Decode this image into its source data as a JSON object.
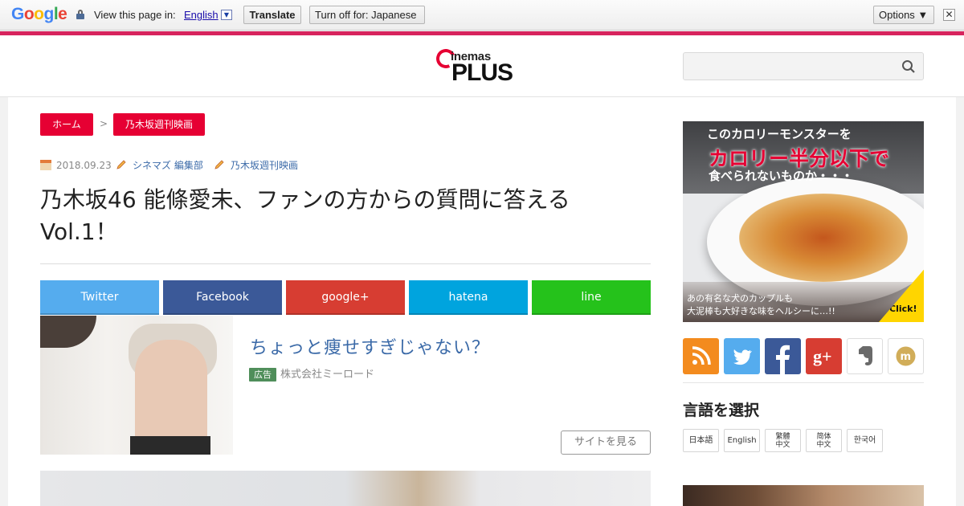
{
  "translate_bar": {
    "logo": "Google",
    "prompt": "View this page in:",
    "language": "English",
    "translate_label": "Translate",
    "turnoff_label": "Turn off for: Japanese",
    "options_label": "Options ▼",
    "close_glyph": "✕"
  },
  "header": {
    "logo_top": "inemas",
    "logo_bottom": "PLUS",
    "search": {
      "value": "",
      "placeholder": ""
    },
    "accent_color": "#d7245d"
  },
  "breadcrumb": {
    "home": "ホーム",
    "separator": ">",
    "category": "乃木坂週刊映画"
  },
  "meta": {
    "date": "2018.09.23",
    "author": "シネマズ 編集部",
    "category": "乃木坂週刊映画"
  },
  "article": {
    "title": "乃木坂46 能條愛未、ファンの方からの質問に答える Vol.1！"
  },
  "share": {
    "twitter": "Twitter",
    "facebook": "Facebook",
    "google": "google+",
    "hatena": "hatena",
    "line": "line"
  },
  "ad": {
    "title": "ちょっと痩せすぎじゃない？",
    "badge": "広告",
    "sponsor": "株式会社ミーロード",
    "cta": "サイトを見る"
  },
  "sidebar": {
    "banner": {
      "line1": "このカロリーモンスターを",
      "line2": "カロリー半分以下で",
      "line3": "食べられないものか・・・",
      "line4": "あの有名な犬のカップルも",
      "line5": "大泥棒も大好きな味をヘルシーに…!!",
      "click": "Click!"
    },
    "sns_icons": [
      "rss-icon",
      "twitter-icon",
      "facebook-icon",
      "google-plus-icon",
      "evernote-icon",
      "mixi-icon"
    ],
    "language_title": "言語を選択",
    "languages": {
      "ja": "日本語",
      "en": "English",
      "zh_hant": "繁體中文",
      "zh_hans": "简体中文",
      "ko": "한국어"
    }
  }
}
